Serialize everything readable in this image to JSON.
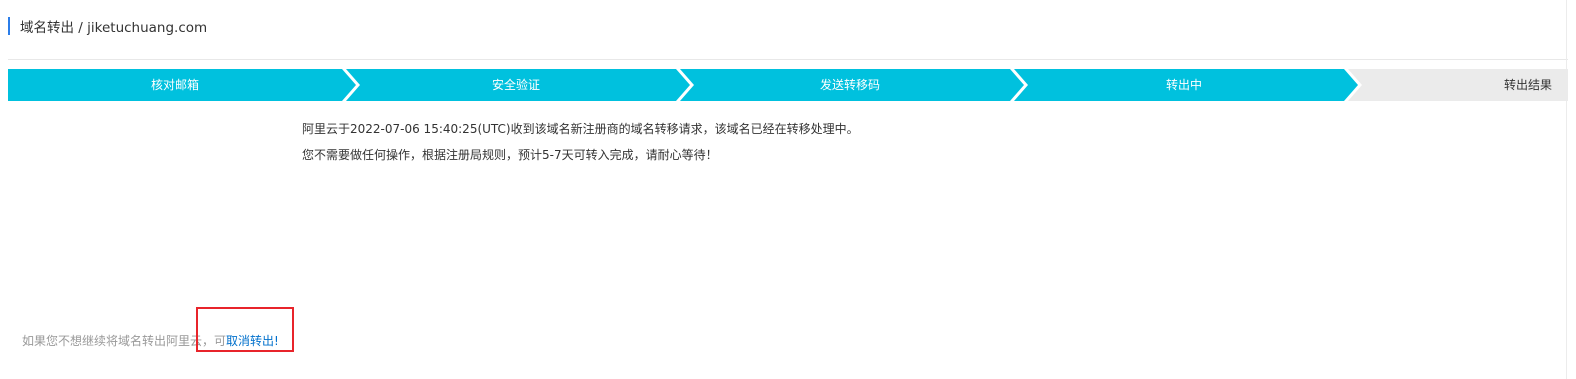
{
  "header": {
    "title": "域名转出 / jiketuchuang.com"
  },
  "steps": [
    {
      "label": "核对邮箱",
      "state": "done"
    },
    {
      "label": "安全验证",
      "state": "done"
    },
    {
      "label": "发送转移码",
      "state": "done"
    },
    {
      "label": "转出中",
      "state": "current"
    },
    {
      "label": "转出结果",
      "state": "pending"
    }
  ],
  "colors": {
    "active_step": "#00c1de",
    "pending_step": "#ebebeb",
    "link": "#0070cc",
    "highlight": "#e8242b",
    "accent_bar": "#2b7de9"
  },
  "message": {
    "line1": "阿里云于2022-07-06 15:40:25(UTC)收到该域名新注册商的域名转移请求，该域名已经在转移处理中。",
    "line2": "您不需要做任何操作，根据注册局规则，预计5-7天可转入完成，请耐心等待！"
  },
  "footer": {
    "note_prefix": "如果您不想继续将域名转出阿里云，可",
    "cancel_link": "取消转出!"
  }
}
